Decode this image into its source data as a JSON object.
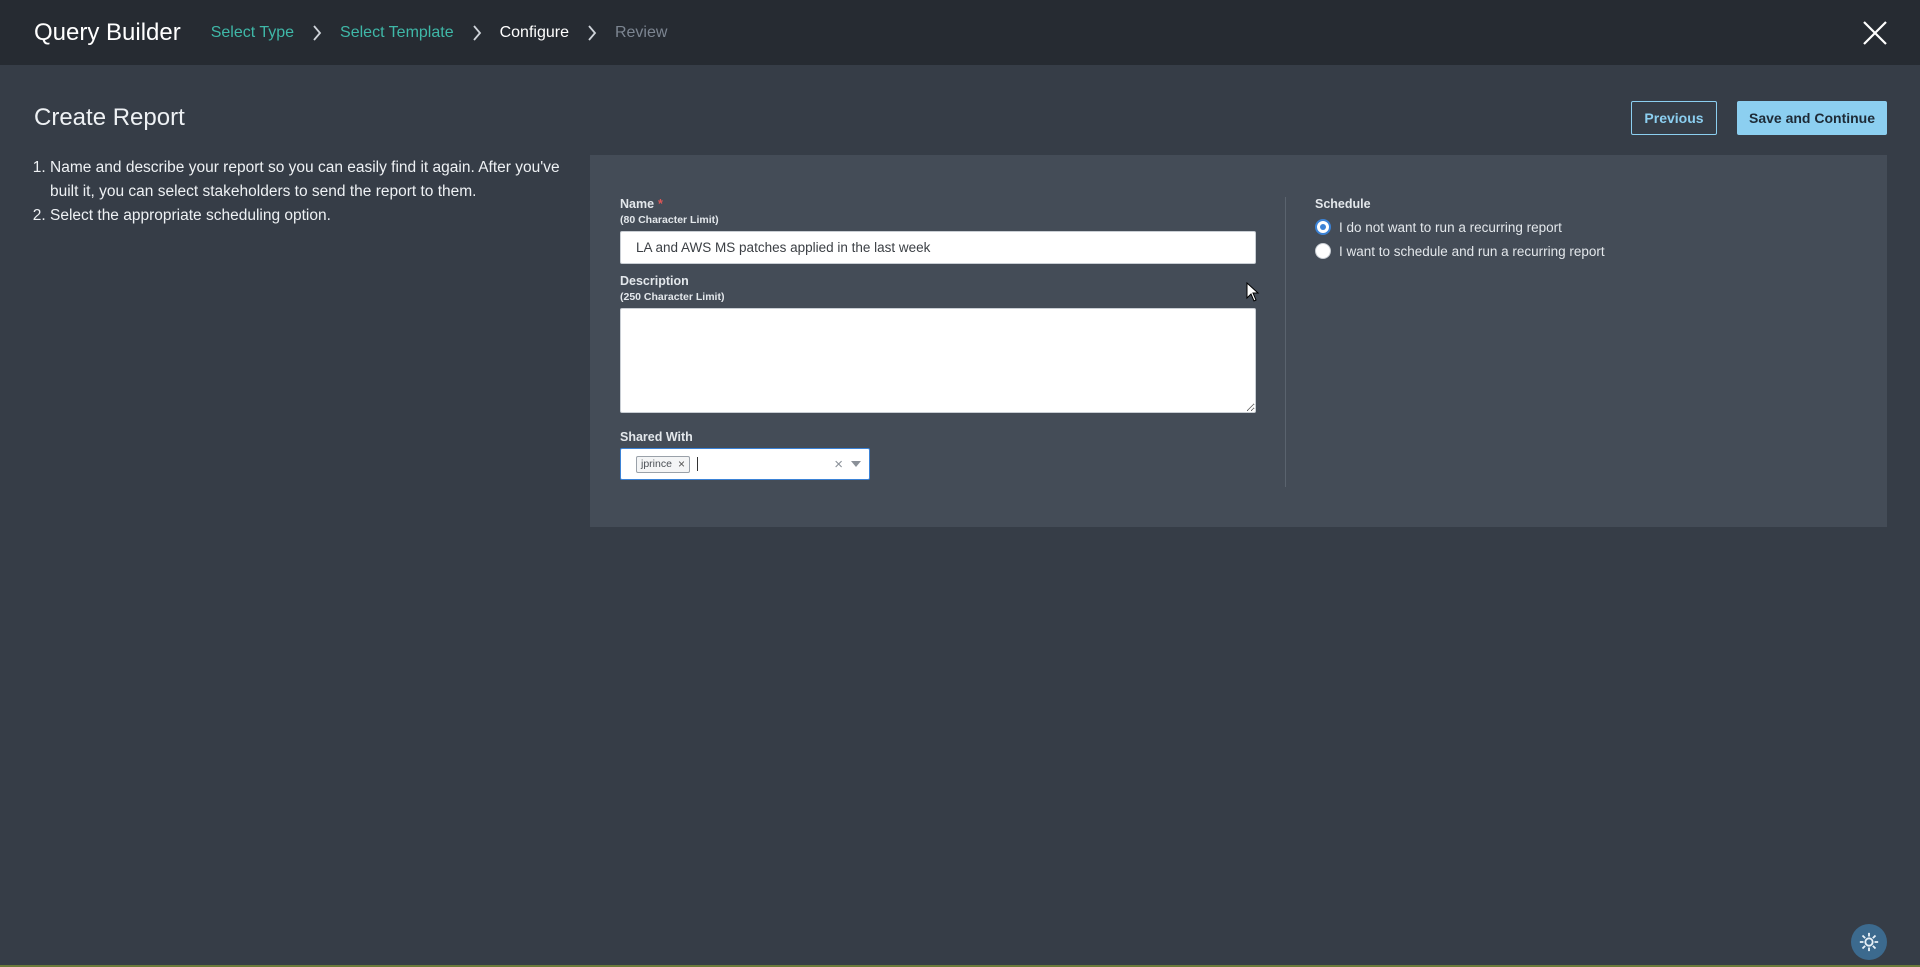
{
  "header": {
    "app_title": "Query Builder",
    "breadcrumbs": [
      {
        "label": "Select Type",
        "state": "done"
      },
      {
        "label": "Select Template",
        "state": "done"
      },
      {
        "label": "Configure",
        "state": "current"
      },
      {
        "label": "Review",
        "state": "future"
      }
    ],
    "close_icon": "close-icon"
  },
  "page": {
    "title": "Create Report",
    "instructions": [
      "Name and describe your report so you can easily find it again. After you've built it, you can select stakeholders to send the report to them.",
      "Select the appropriate scheduling option."
    ]
  },
  "actions": {
    "previous_label": "Previous",
    "save_label": "Save and Continue"
  },
  "form": {
    "name_label": "Name",
    "name_required_mark": "*",
    "name_limit": "(80 Character Limit)",
    "name_value": "LA and AWS MS patches applied in the last week",
    "description_label": "Description",
    "description_limit": "(250 Character Limit)",
    "description_value": "",
    "shared_label": "Shared With",
    "shared_chips": [
      "jprince"
    ],
    "schedule_label": "Schedule",
    "schedule_options": [
      {
        "label": "I do not want to run a recurring report",
        "checked": true
      },
      {
        "label": "I want to schedule and run a recurring report",
        "checked": false
      }
    ]
  },
  "colors": {
    "background": "#363d47",
    "header": "#262b32",
    "panel": "#444c57",
    "accent": "#8ccff0",
    "breadcrumb_done": "#3fb8a8",
    "focus_blue": "#3b82d6"
  }
}
